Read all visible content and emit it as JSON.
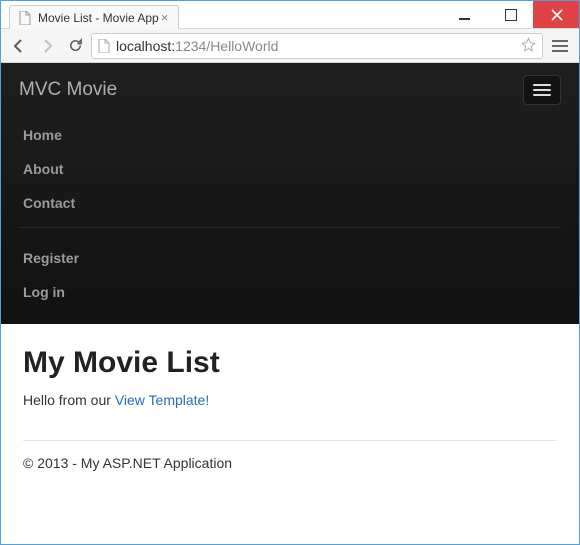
{
  "window": {
    "tab_title": "Movie List - Movie App"
  },
  "toolbar": {
    "url_host": "localhost:",
    "url_port_path": "1234/HelloWorld"
  },
  "navbar": {
    "brand": "MVC Movie",
    "items_a": [
      "Home",
      "About",
      "Contact"
    ],
    "items_b": [
      "Register",
      "Log in"
    ]
  },
  "page": {
    "heading": "My Movie List",
    "greeting_prefix": "Hello from our ",
    "greeting_link": "View Template!",
    "footer": "© 2013 - My ASP.NET Application"
  }
}
